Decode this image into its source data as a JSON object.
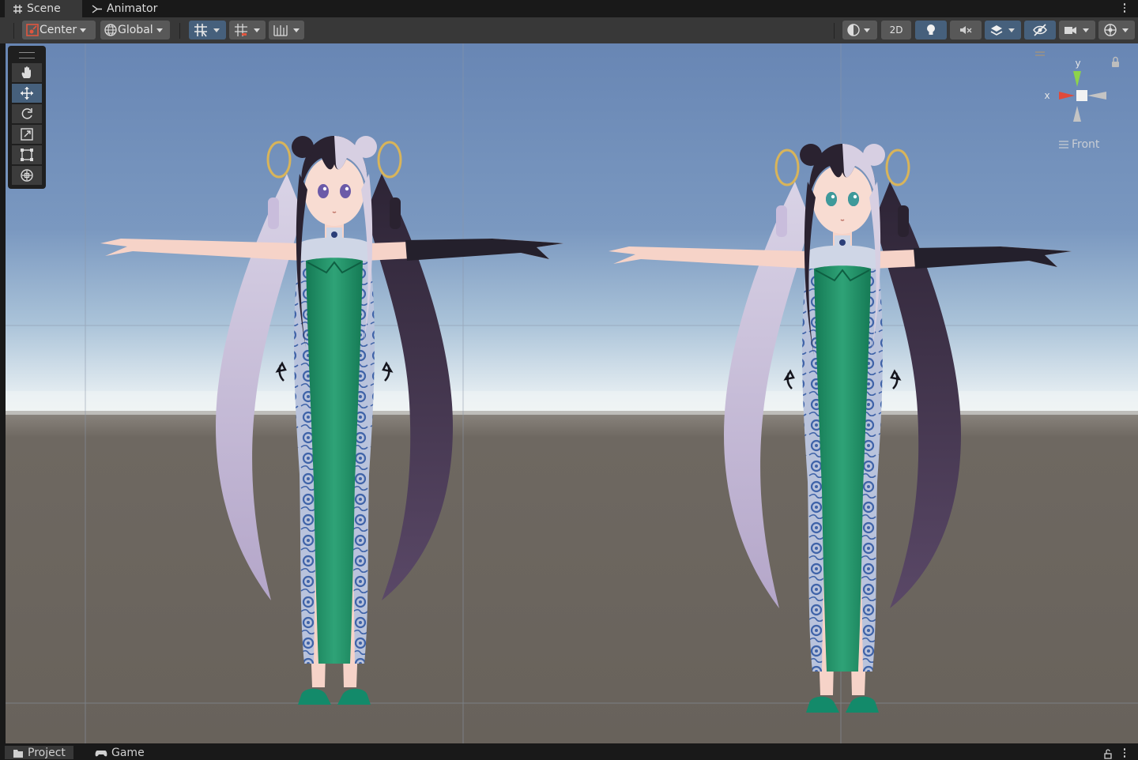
{
  "tabs": [
    {
      "label": "Scene",
      "icon": "grid-hash-icon"
    },
    {
      "label": "Animator",
      "icon": "animator-icon"
    }
  ],
  "toolbar": {
    "pivot_mode": "Center",
    "pivot_rotation": "Global",
    "mode_2d": "2D"
  },
  "gizmo": {
    "y_label": "y",
    "x_label": "x",
    "view_label": "Front"
  },
  "bottom_tabs": [
    {
      "label": "Project",
      "icon": "folder-icon"
    },
    {
      "label": "Game",
      "icon": "gamepad-icon"
    }
  ],
  "colors": {
    "panel_bg": "#383838",
    "tab_bar_bg": "#191919",
    "button_bg": "#585858",
    "active_blue": "#46607c",
    "sky_top": "#6886b4",
    "horizon": "#e6eef2",
    "ground": "#6a645d",
    "gizmo_x": "#e04a3a",
    "gizmo_y": "#8ed34a",
    "dress_green": "#1e8a62",
    "dress_blue_pattern": "#4a6fb0"
  },
  "scene": {
    "characters": [
      {
        "name": "avatar-left",
        "eyes": "violet"
      },
      {
        "name": "avatar-right",
        "eyes": "teal"
      }
    ]
  }
}
